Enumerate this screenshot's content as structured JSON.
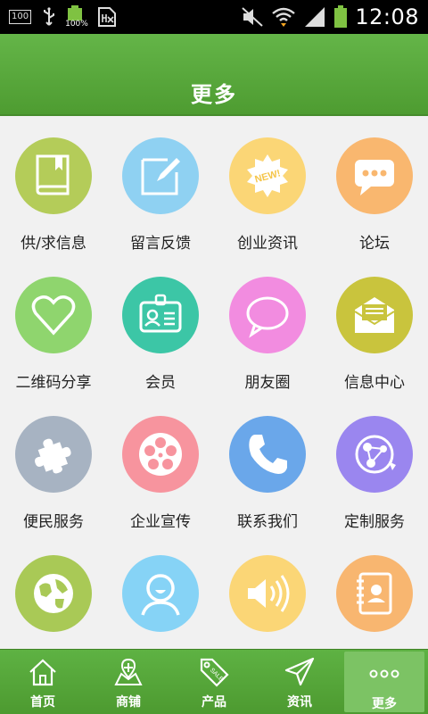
{
  "status_bar": {
    "left_badge": "100",
    "battery_pct": "100%",
    "time": "12:08"
  },
  "header": {
    "title": "更多"
  },
  "grid_items": [
    {
      "label": "供/求信息",
      "icon": "book-icon",
      "color": "#b4cc59"
    },
    {
      "label": "留言反馈",
      "icon": "edit-icon",
      "color": "#8fd1f2"
    },
    {
      "label": "创业资讯",
      "icon": "new-badge-icon",
      "color": "#fbd676"
    },
    {
      "label": "论坛",
      "icon": "chat-bubble-icon",
      "color": "#f9b76f"
    },
    {
      "label": "二维码分享",
      "icon": "heart-icon",
      "color": "#8fd56e"
    },
    {
      "label": "会员",
      "icon": "id-card-icon",
      "color": "#3cc6a6"
    },
    {
      "label": "朋友圈",
      "icon": "speech-bubble-icon",
      "color": "#f28ce0"
    },
    {
      "label": "信息中心",
      "icon": "mail-icon",
      "color": "#c9c43d"
    },
    {
      "label": "便民服务",
      "icon": "puzzle-icon",
      "color": "#a7b3c2"
    },
    {
      "label": "企业宣传",
      "icon": "film-reel-icon",
      "color": "#f7949e"
    },
    {
      "label": "联系我们",
      "icon": "phone-icon",
      "color": "#6aa7ea"
    },
    {
      "label": "定制服务",
      "icon": "network-icon",
      "color": "#9a86ef"
    },
    {
      "label": "",
      "icon": "globe-icon",
      "color": "#a9c956"
    },
    {
      "label": "",
      "icon": "user-icon",
      "color": "#86d3f6"
    },
    {
      "label": "",
      "icon": "speaker-icon",
      "color": "#fbd676"
    },
    {
      "label": "",
      "icon": "contacts-book-icon",
      "color": "#f8b670"
    }
  ],
  "bottom_nav": [
    {
      "label": "首页",
      "icon": "home-icon"
    },
    {
      "label": "商铺",
      "icon": "shop-icon"
    },
    {
      "label": "产品",
      "icon": "sale-tag-icon"
    },
    {
      "label": "资讯",
      "icon": "paper-plane-icon"
    },
    {
      "label": "更多",
      "icon": "more-dots-icon"
    }
  ]
}
